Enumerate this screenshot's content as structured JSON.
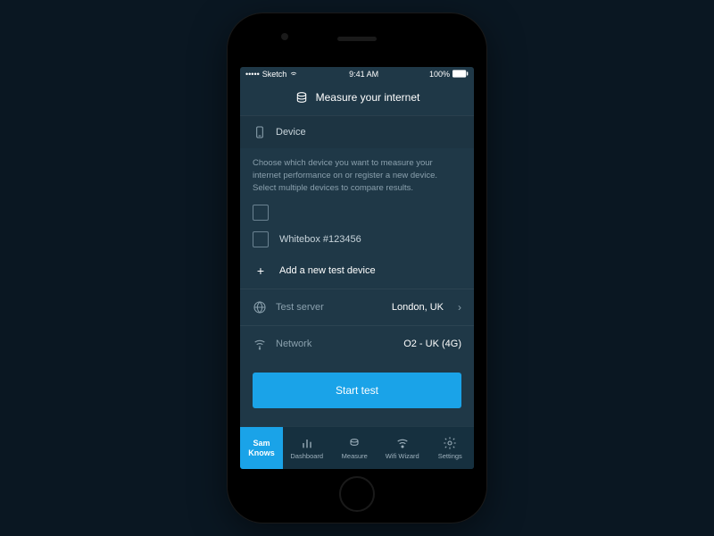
{
  "status_bar": {
    "carrier": "Sketch",
    "time": "9:41 AM",
    "battery": "100%"
  },
  "header": {
    "title": "Measure your internet"
  },
  "device_section": {
    "label": "Device",
    "description": "Choose which device you want to measure your internet performance on or register a new device. Select multiple devices to compare results.",
    "items": [
      {
        "label": ""
      },
      {
        "label": "Whitebox #123456"
      }
    ],
    "add_label": "Add a new test device"
  },
  "test_server": {
    "label": "Test server",
    "value": "London, UK"
  },
  "network": {
    "label": "Network",
    "value": "O2 - UK (4G)"
  },
  "cta": {
    "start": "Start test"
  },
  "tabs": {
    "brand_line1": "Sam",
    "brand_line2": "Knows",
    "dashboard": "Dashboard",
    "measure": "Measure",
    "wifi": "Wifi Wizard",
    "settings": "Settings"
  }
}
